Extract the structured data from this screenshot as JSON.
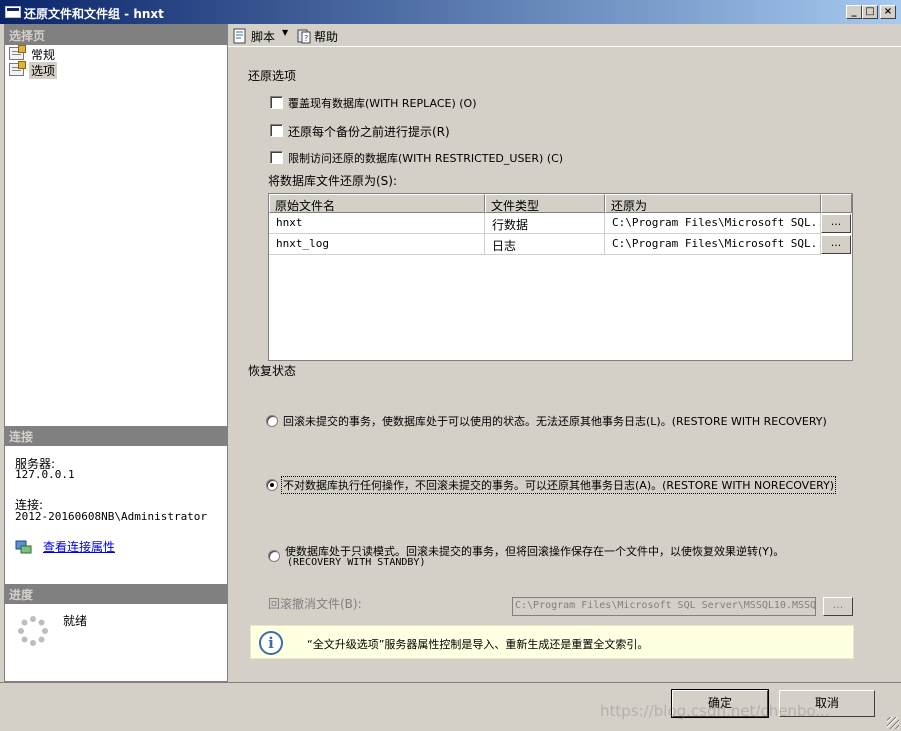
{
  "window": {
    "title": "还原文件和文件组 - hnxt"
  },
  "sidebar": {
    "select_page_header": "选择页",
    "items": [
      {
        "label": "常规",
        "icon": "page-icon"
      },
      {
        "label": "选项",
        "icon": "page-icon",
        "selected": true
      }
    ],
    "connection_header": "连接",
    "server_label": "服务器:",
    "server_value": "127.0.0.1",
    "connection_label": "连接:",
    "connection_value": "2012-20160608NB\\Administrator",
    "view_connection_link": "查看连接属性",
    "progress_header": "进度",
    "progress_status": "就绪"
  },
  "toolbar": {
    "script_label": "脚本",
    "help_label": "帮助"
  },
  "restore_options": {
    "header": "还原选项",
    "checkboxes": [
      {
        "label": "覆盖现有数据库(WITH REPLACE) (O)",
        "checked": false
      },
      {
        "label": "还原每个备份之前进行提示(R)",
        "checked": false
      },
      {
        "label": "限制访问还原的数据库(WITH RESTRICTED_USER) (C)",
        "checked": false
      }
    ],
    "restore_as_label": "将数据库文件还原为(S):",
    "grid": {
      "columns": [
        "原始文件名",
        "文件类型",
        "还原为"
      ],
      "rows": [
        {
          "name": "hnxt",
          "type": "行数据",
          "restore_as": "C:\\Program Files\\Microsoft SQL...",
          "button": "..."
        },
        {
          "name": "hnxt_log",
          "type": "日志",
          "restore_as": "C:\\Program Files\\Microsoft SQL...",
          "button": "..."
        }
      ]
    }
  },
  "recovery_state": {
    "header": "恢复状态",
    "options": [
      {
        "label": "回滚未提交的事务，使数据库处于可以使用的状态。无法还原其他事务日志(L)。(RESTORE WITH RECOVERY)",
        "selected": false
      },
      {
        "label": "不对数据库执行任何操作，不回滚未提交的事务。可以还原其他事务日志(A)。(RESTORE WITH NORECOVERY)",
        "selected": true
      },
      {
        "label": "使数据库处于只读模式。回滚未提交的事务，但将回滚操作保存在一个文件中，以使恢复效果逆转(Y)。",
        "label2": "(RECOVERY WITH STANDBY)",
        "selected": false
      }
    ],
    "undo_file_label": "回滚撤消文件(B):",
    "undo_file_value": "C:\\Program Files\\Microsoft SQL Server\\MSSQL10.MSSQ",
    "undo_button": "..."
  },
  "info": {
    "text": "“全文升级选项”服务器属性控制是导入、重新生成还是重置全文索引。"
  },
  "buttons": {
    "ok": "确定",
    "cancel": "取消"
  },
  "watermark": "https://blog.csdn.net/chenbo..."
}
